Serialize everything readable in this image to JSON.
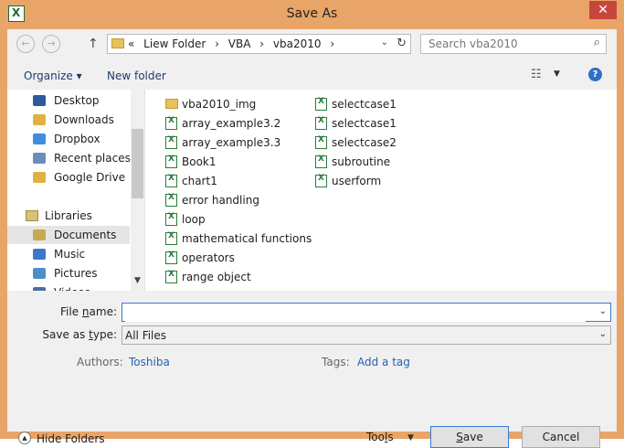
{
  "window": {
    "title": "Save As",
    "close_glyph": "✕"
  },
  "nav_buttons": {
    "back": "←",
    "forward": "→",
    "up": "↑"
  },
  "address": {
    "crumbs": [
      "«",
      "Liew Folder",
      "›",
      "VBA",
      "›",
      "vba2010",
      "›"
    ],
    "dropdown": "⌄",
    "refresh": "↻"
  },
  "search": {
    "placeholder": "Search vba2010",
    "icon": "search-icon"
  },
  "toolbar": {
    "organize": "Organize ▾",
    "new_folder": "New folder",
    "view_glyph": "☷",
    "help": "?"
  },
  "sidebar": {
    "items": [
      {
        "label": "Desktop",
        "color": "#2c5aa0"
      },
      {
        "label": "Downloads",
        "color": "#e0b040"
      },
      {
        "label": "Dropbox",
        "color": "#3d8de0"
      },
      {
        "label": "Recent places",
        "color": "#6b8fb8"
      },
      {
        "label": "Google Drive",
        "color": "#e0b040"
      }
    ],
    "libraries": "Libraries",
    "lib_items": [
      {
        "label": "Documents",
        "color": "#c8a850"
      },
      {
        "label": "Music",
        "color": "#3b78c8"
      },
      {
        "label": "Pictures",
        "color": "#4a90c8"
      },
      {
        "label": "Videos",
        "color": "#4a6fa0"
      }
    ]
  },
  "files": {
    "col1": [
      {
        "label": "vba2010_img",
        "type": "folder"
      },
      {
        "label": "array_example3.2",
        "type": "excel"
      },
      {
        "label": "array_example3.3",
        "type": "excel"
      },
      {
        "label": "Book1",
        "type": "excel"
      },
      {
        "label": "chart1",
        "type": "excel"
      },
      {
        "label": "error handling",
        "type": "excel"
      },
      {
        "label": "loop",
        "type": "excel"
      },
      {
        "label": "mathematical functions",
        "type": "excel"
      },
      {
        "label": "operators",
        "type": "excel"
      },
      {
        "label": "range object",
        "type": "excel"
      }
    ],
    "col2": [
      {
        "label": "selectcase1",
        "type": "excel"
      },
      {
        "label": "selectcase1",
        "type": "excel"
      },
      {
        "label": "selectcase2",
        "type": "excel"
      },
      {
        "label": "subroutine",
        "type": "excel"
      },
      {
        "label": "userform",
        "type": "excel"
      }
    ]
  },
  "form": {
    "file_name_label_pre": "File ",
    "file_name_label_u": "n",
    "file_name_label_post": "ame:",
    "file_name_value": "",
    "save_type_label_pre": "Save as ",
    "save_type_label_u": "t",
    "save_type_label_post": "ype:",
    "save_type_value": "All Files",
    "authors_label": "Authors:",
    "authors_value": "Toshiba",
    "tags_label": "Tags:",
    "tags_value": "Add a tag"
  },
  "footer": {
    "hide_folders": "Hide Folders",
    "tools_pre": "Too",
    "tools_u": "l",
    "tools_post": "s",
    "save_u": "S",
    "save_post": "ave",
    "cancel": "Cancel"
  }
}
